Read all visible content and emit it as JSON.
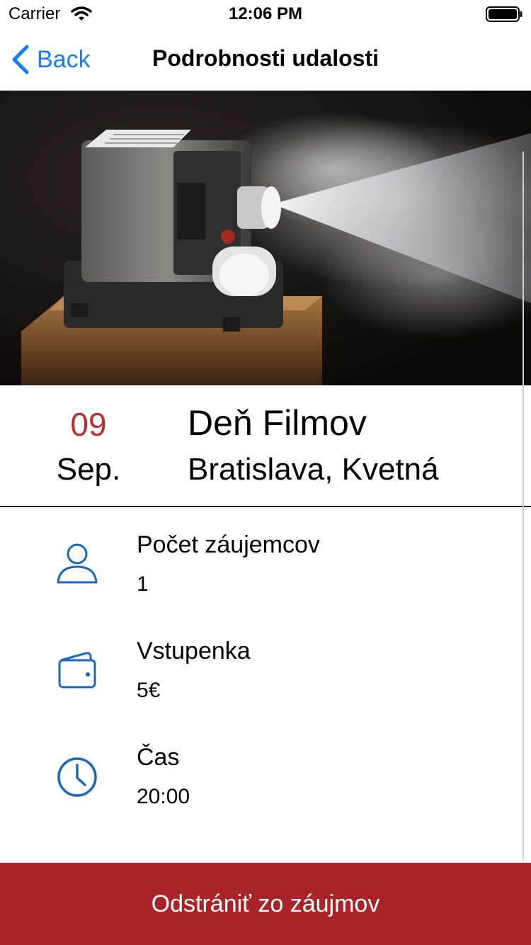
{
  "status_bar": {
    "carrier": "Carrier",
    "time": "12:06 PM",
    "wifi_icon": "wifi-icon",
    "battery_icon": "battery-icon"
  },
  "nav": {
    "back_label": "Back",
    "title": "Podrobnosti udalosti",
    "accent_color": "#1a7cf7"
  },
  "hero": {
    "description": "movie-projector-photo"
  },
  "event": {
    "day": "09",
    "month": "Sep.",
    "title": "Deň Filmov",
    "location": "Bratislava, Kvetná",
    "day_color": "#b5312f"
  },
  "details": [
    {
      "icon": "person-icon",
      "label": "Počet záujemcov",
      "value": "1"
    },
    {
      "icon": "wallet-icon",
      "label": "Vstupenka",
      "value": "5€"
    },
    {
      "icon": "clock-icon",
      "label": "Čas",
      "value": "20:00"
    }
  ],
  "action": {
    "remove_label": "Odstrániť zo záujmov",
    "color": "#a82428"
  }
}
